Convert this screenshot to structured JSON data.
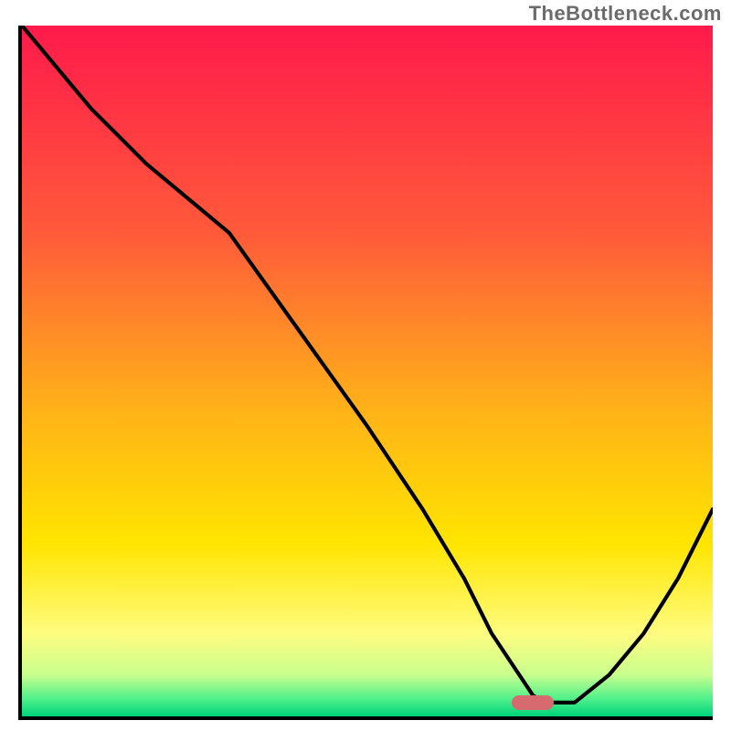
{
  "watermark": "TheBottleneck.com",
  "colors": {
    "gradient_stops": [
      {
        "offset": 0.0,
        "color": "#ff1a4b"
      },
      {
        "offset": 0.3,
        "color": "#ff5a3a"
      },
      {
        "offset": 0.55,
        "color": "#ffb019"
      },
      {
        "offset": 0.75,
        "color": "#ffe500"
      },
      {
        "offset": 0.88,
        "color": "#fffc80"
      },
      {
        "offset": 0.94,
        "color": "#c8ff8e"
      },
      {
        "offset": 0.975,
        "color": "#4ef08a"
      },
      {
        "offset": 1.0,
        "color": "#00d37a"
      }
    ],
    "curve": "#000000",
    "marker": "#d76a6f",
    "axis": "#000000"
  },
  "chart_data": {
    "type": "line",
    "title": "",
    "xlabel": "",
    "ylabel": "",
    "xlim": [
      0,
      100
    ],
    "ylim": [
      0,
      100
    ],
    "grid": false,
    "legend": null,
    "x": [
      0,
      5,
      10,
      18,
      24,
      30,
      40,
      50,
      58,
      64,
      68,
      72,
      74,
      76,
      80,
      85,
      90,
      95,
      100
    ],
    "values": [
      100,
      94,
      88,
      80,
      75,
      70,
      56,
      42,
      30,
      20,
      12,
      6,
      3,
      2,
      2,
      6,
      12,
      20,
      30
    ],
    "annotations": [
      {
        "kind": "marker",
        "shape": "pill",
        "x": 74,
        "y": 2,
        "color": "#d76a6f"
      }
    ],
    "note": "x and y are percentages of the plot area (0 = left/bottom, 100 = right/top). Values estimated from pixels; no axis tick labels are visible."
  }
}
